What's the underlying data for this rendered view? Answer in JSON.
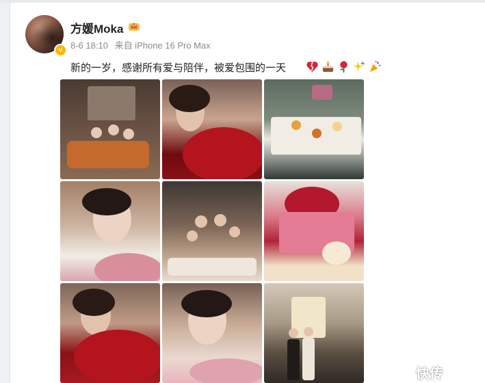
{
  "post": {
    "username": "方媛Moka",
    "timestamp": "8-6 18:10",
    "source": "来自 iPhone 16 Pro Max",
    "text": "新的一岁，感谢所有爱与陪伴，被爱包围的一天",
    "emoji_icons": [
      "broken-heart-icon",
      "cake-icon",
      "rose-icon",
      "sparkles-icon",
      "party-popper-icon"
    ]
  },
  "colors": {
    "background": "#eef0f3",
    "card": "#ffffff",
    "verified_badge": "#ffb400",
    "meta_text": "#8a8a8a"
  },
  "photos": [
    {
      "name": "photo-family-living-room"
    },
    {
      "name": "photo-selfie-red-roses"
    },
    {
      "name": "photo-dessert-platter"
    },
    {
      "name": "photo-selfie-pink-roses"
    },
    {
      "name": "photo-family-dinner"
    },
    {
      "name": "photo-birthday-cake"
    },
    {
      "name": "photo-selfie-red-roses-2"
    },
    {
      "name": "photo-selfie-pink-roses-2"
    },
    {
      "name": "photo-family-hallway"
    }
  ],
  "watermark": "快传"
}
